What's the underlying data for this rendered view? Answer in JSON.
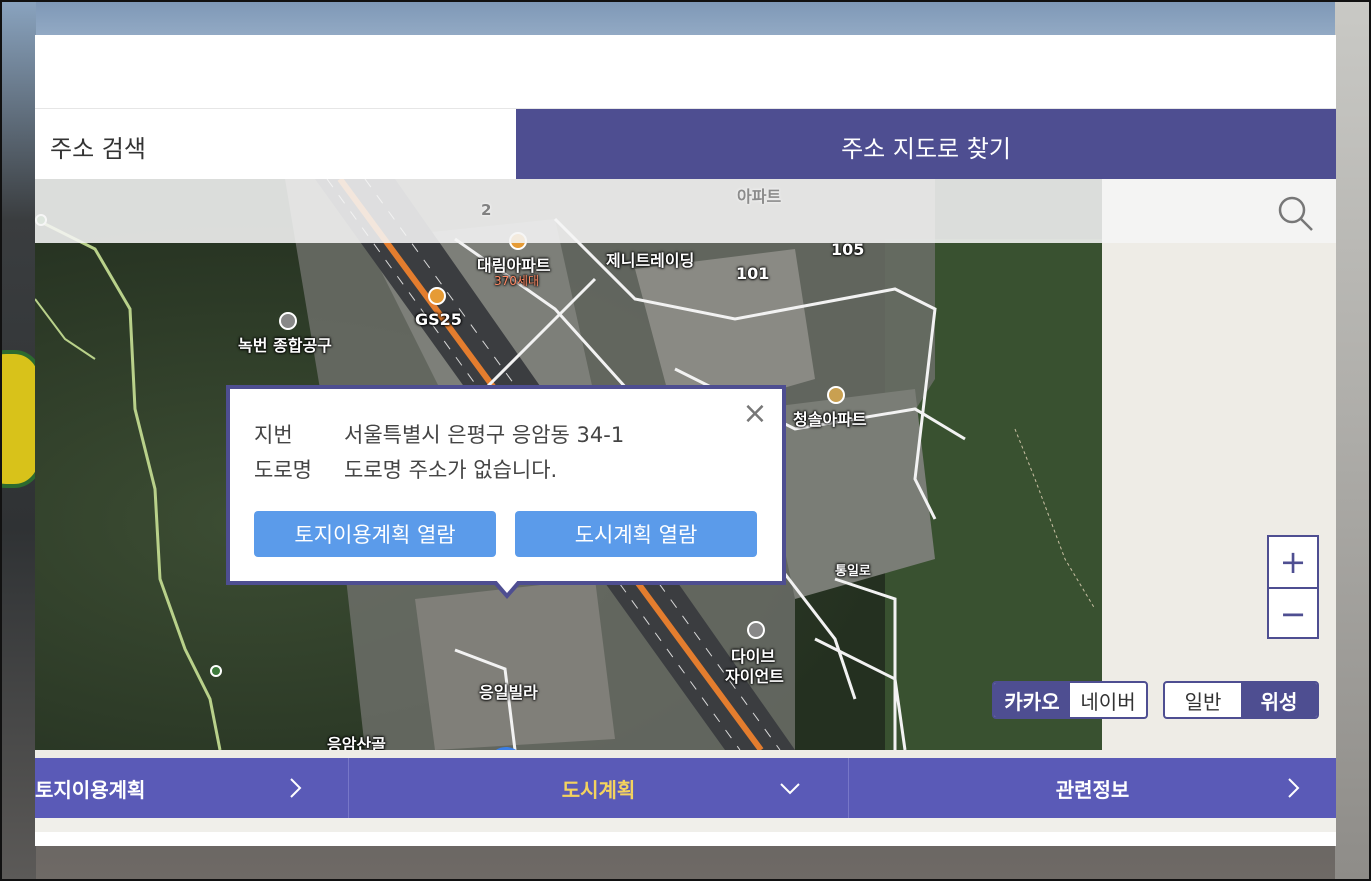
{
  "tabs": {
    "address_search": "주소 검색",
    "map_find": "주소 지도로 찾기"
  },
  "map": {
    "labels": [
      "대림아파트",
      "370세대",
      "제니트레이딩",
      "105",
      "101",
      "GS25",
      "녹번 종합공구",
      "청솔아파트",
      "다이브",
      "자이언트",
      "통일로",
      "응일빌라",
      "응암산골",
      "2",
      "아파트",
      "아파트"
    ]
  },
  "popup": {
    "jibun_key": "지번",
    "jibun_value": "서울특별시 은평구 응암동 34-1",
    "road_key": "도로명",
    "road_value": "도로명 주소가 없습니다.",
    "btn_land": "토지이용계획 열람",
    "btn_city": "도시계획 열람",
    "close": "×"
  },
  "zoom": {
    "in": "+",
    "out": "−"
  },
  "provider": {
    "kakao": "카카오",
    "naver": "네이버",
    "active": "카카오"
  },
  "maptype": {
    "normal": "일반",
    "satellite": "위성",
    "active": "위성"
  },
  "bottom_nav": {
    "land_plan": "토지이용계획",
    "city_plan": "도시계획",
    "related": "관련정보"
  },
  "colors": {
    "accent": "#4e4e91",
    "nav": "#5a5ab7",
    "button": "#5b9bea",
    "city_plan_text": "#f4d35e"
  }
}
